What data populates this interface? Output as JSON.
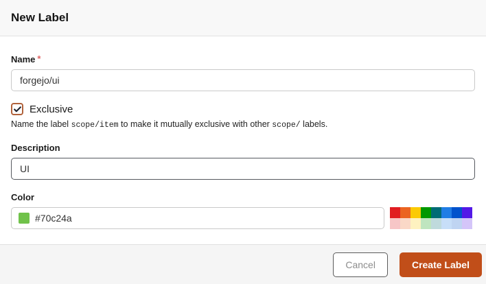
{
  "colors": {
    "accent_button_bg": "#c14e19",
    "checkbox_border": "#b0613a",
    "required_asterisk": "#e06565",
    "selected_swatch": "#70c24a",
    "header_bg": "#f8f8f8",
    "footer_bg": "#f5f5f5"
  },
  "dialog": {
    "title": "New Label",
    "name_field": {
      "label": "Name",
      "required_marker": "*",
      "value": "forgejo/ui"
    },
    "exclusive": {
      "label": "Exclusive",
      "checked": true,
      "help": {
        "part1": "Name the label ",
        "code1": "scope/item",
        "part2": " to make it mutually exclusive with other ",
        "code2": "scope/",
        "part3": " labels."
      }
    },
    "description_field": {
      "label": "Description",
      "value": "UI"
    },
    "color_field": {
      "label": "Color",
      "value": "#70c24a"
    },
    "palette": [
      [
        "#e11d21",
        "#eb6420",
        "#fbca04",
        "#009800",
        "#006b75",
        "#207de5",
        "#0052cc",
        "#5319e7"
      ],
      [
        "#f7c6c7",
        "#fad8c7",
        "#fef2c0",
        "#bfe5bf",
        "#bfdadc",
        "#c7def8",
        "#bfd4f2",
        "#d4c5f9"
      ]
    ],
    "footer": {
      "cancel_label": "Cancel",
      "create_label": "Create Label"
    }
  }
}
